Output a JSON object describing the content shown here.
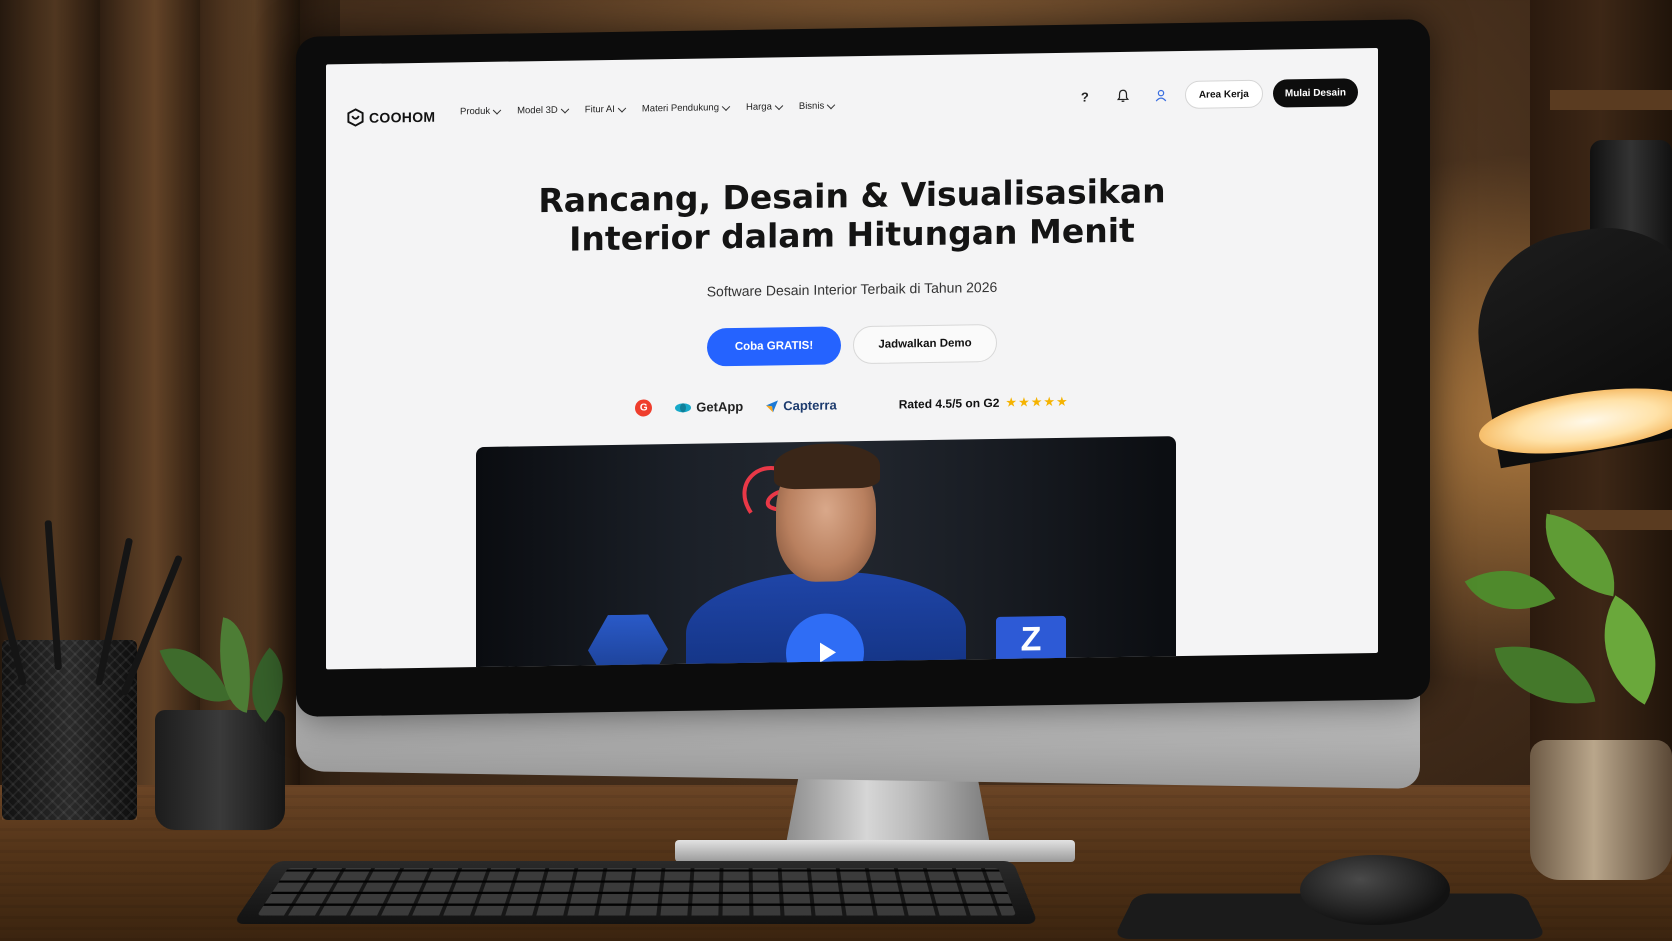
{
  "nav": {
    "logo_text": "COOHOM",
    "menu": [
      {
        "label": "Produk"
      },
      {
        "label": "Model 3D"
      },
      {
        "label": "Fitur AI"
      },
      {
        "label": "Materi Pendukung"
      },
      {
        "label": "Harga"
      },
      {
        "label": "Bisnis"
      }
    ],
    "help_label": "?",
    "workspace_label": "Area Kerja",
    "start_label": "Mulai Desain"
  },
  "hero": {
    "title_line1": "Rancang, Desain & Visualisasikan",
    "title_line2": "Interior dalam Hitungan Menit",
    "subtitle": "Software Desain Interior Terbaik di Tahun 2026",
    "primary_cta": "Coba GRATIS!",
    "secondary_cta": "Jadwalkan Demo"
  },
  "ratings": {
    "g2_mark": "G",
    "getapp": "GetApp",
    "capterra": "Capterra",
    "rated_text": "Rated 4.5/5 on G2",
    "stars": "★★★★★",
    "star_value": 4.5,
    "star_max": 5
  },
  "video": {
    "badge_letter": "Z"
  },
  "colors": {
    "primary": "#2563ff",
    "dark_button": "#0d0d0d",
    "screen_bg": "#f4f4f5",
    "star": "#f5b300",
    "g2_red": "#ef3e2d",
    "getapp_teal": "#17a9c9",
    "capterra_blue": "#1d3b6e"
  }
}
